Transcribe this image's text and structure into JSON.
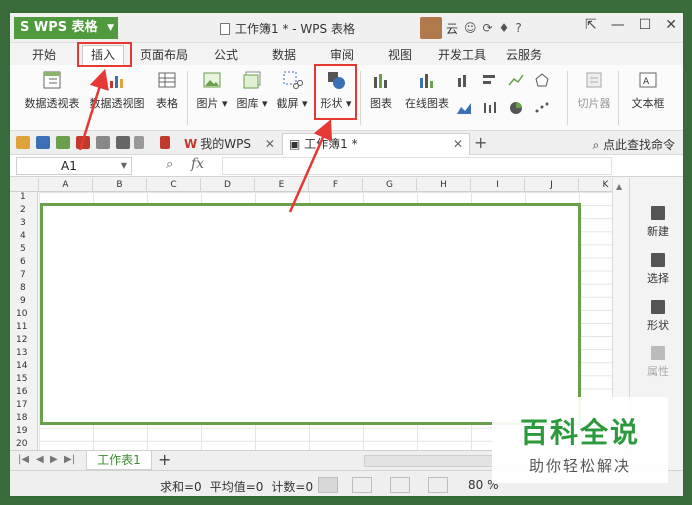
{
  "app": {
    "button_label": "WPS 表格",
    "window_title": "工作簿1 * - WPS 表格",
    "user_name": "云",
    "help": "?"
  },
  "menu_tabs": [
    "开始",
    "插入",
    "页面布局",
    "公式",
    "数据",
    "审阅",
    "视图",
    "开发工具",
    "云服务"
  ],
  "active_menu_tab": "插入",
  "ribbon": {
    "pivot_table": "数据透视表",
    "pivot_chart": "数据透视图",
    "table": "表格",
    "picture": "图片",
    "gallery": "图库",
    "screenshot": "截屏",
    "shapes": "形状",
    "chart": "图表",
    "online_chart": "在线图表",
    "slicer": "切片器",
    "textbox": "文本框"
  },
  "tabs": {
    "my_wps": "我的WPS",
    "active_doc": "工作簿1 *",
    "find_command": "点此查找命令"
  },
  "formula_bar": {
    "name_box": "A1",
    "fx": "fx"
  },
  "columns": [
    "A",
    "B",
    "C",
    "D",
    "E",
    "F",
    "G",
    "H",
    "I",
    "J",
    "K"
  ],
  "rows": [
    "1",
    "2",
    "3",
    "4",
    "5",
    "6",
    "7",
    "8",
    "9",
    "10",
    "11",
    "12",
    "13",
    "14",
    "15",
    "16",
    "17",
    "18",
    "19",
    "20"
  ],
  "side_panel": {
    "new": "新建",
    "select": "选择",
    "shape": "形状",
    "properties": "属性"
  },
  "sheet": {
    "name": "工作表1",
    "add": "+"
  },
  "status": {
    "sum": "求和=0",
    "average": "平均值=0",
    "count": "计数=0",
    "zoom": "80 %"
  },
  "watermark": {
    "title": "百科全说",
    "subtitle": "助你轻松解决"
  },
  "colors": {
    "brand_green": "#4e9a3c",
    "selection_green": "#6a9f4b",
    "annotation_red": "#e53935"
  }
}
